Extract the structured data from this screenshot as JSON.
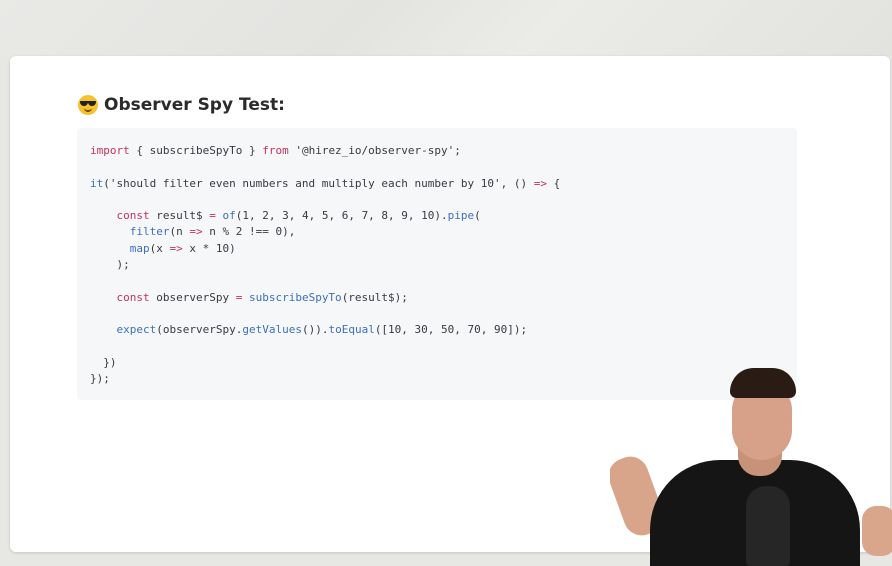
{
  "heading": {
    "emoji": "sunglasses-face",
    "title": "Observer Spy Test:"
  },
  "code": {
    "line1": {
      "kw1": "import",
      "mid": " { subscribeSpyTo } ",
      "kw2": "from",
      "str": " '@hirez_io/observer-spy';"
    },
    "line3": {
      "fn": "it",
      "text": "('should filter even numbers and multiply each number by 10', () ",
      "op": "=>",
      "tail": " {"
    },
    "line5": {
      "kw": "const",
      "text": " result$ ",
      "op": "=",
      "fn": " of",
      "args": "(1, 2, 3, 4, 5, 6, 7, 8, 9, 10).",
      "fn2": "pipe",
      "tail": "("
    },
    "line6": {
      "fn": "filter",
      "text": "(n ",
      "op": "=>",
      "tail": " n % 2 !== 0),"
    },
    "line7": {
      "fn": "map",
      "text": "(x ",
      "op": "=>",
      "tail": " x * 10)"
    },
    "line8": ");",
    "line10": {
      "kw": "const",
      "text": " observerSpy ",
      "op": "=",
      "fn": " subscribeSpyTo",
      "tail": "(result$);"
    },
    "line12": {
      "fn": "expect",
      "text": "(observerSpy.",
      "fn2": "getValues",
      "mid": "()).",
      "fn3": "toEqual",
      "tail": "([10, 30, 50, 70, 90]);"
    },
    "line14": "})",
    "line15": "});"
  },
  "colors": {
    "keyword": "#c4325c",
    "function": "#3d6fc0",
    "codebox_bg": "#f6f7f9"
  }
}
